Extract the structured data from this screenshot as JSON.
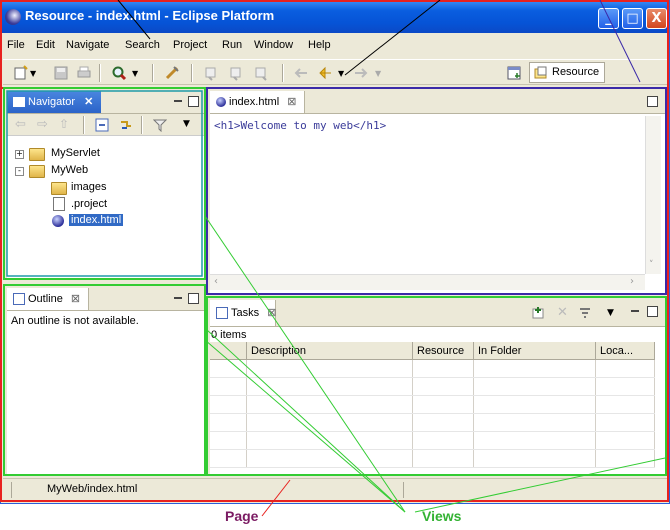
{
  "window": {
    "title": "Resource - index.html - Eclipse Platform",
    "minimize": "_",
    "maximize": "□",
    "close": "X"
  },
  "menu": [
    "File",
    "Edit",
    "Navigate",
    "Search",
    "Project",
    "Run",
    "Window",
    "Help"
  ],
  "toolbar": {
    "perspective_label": "Resource"
  },
  "navigator": {
    "tab_label": "Navigator",
    "close_glyph": "✕",
    "items": [
      {
        "label": "MyServlet",
        "expander": "+"
      },
      {
        "label": "MyWeb",
        "expander": "-"
      },
      {
        "label": "images"
      },
      {
        "label": ".project"
      },
      {
        "label": "index.html"
      }
    ]
  },
  "editor": {
    "tab_label": "index.html",
    "close_glyph": "⊠",
    "content": "<h1>Welcome to my web</h1>"
  },
  "outline": {
    "tab_label": "Outline",
    "close_glyph": "⊠",
    "message": "An outline is not available."
  },
  "tasks": {
    "tab_label": "Tasks",
    "close_glyph": "⊠",
    "count": "0 items",
    "columns": [
      "",
      "Description",
      "Resource",
      "In Folder",
      "Loca..."
    ]
  },
  "statusbar": {
    "path": "MyWeb/index.html"
  },
  "annotations": {
    "page": "Page",
    "views": "Views"
  },
  "colors": {
    "page_outline": "#e8221f",
    "views_outline": "#33cc33",
    "editor_outline": "#3b2aa8",
    "tab_active": "#2b63c8",
    "title_bar": "#0653d6"
  }
}
